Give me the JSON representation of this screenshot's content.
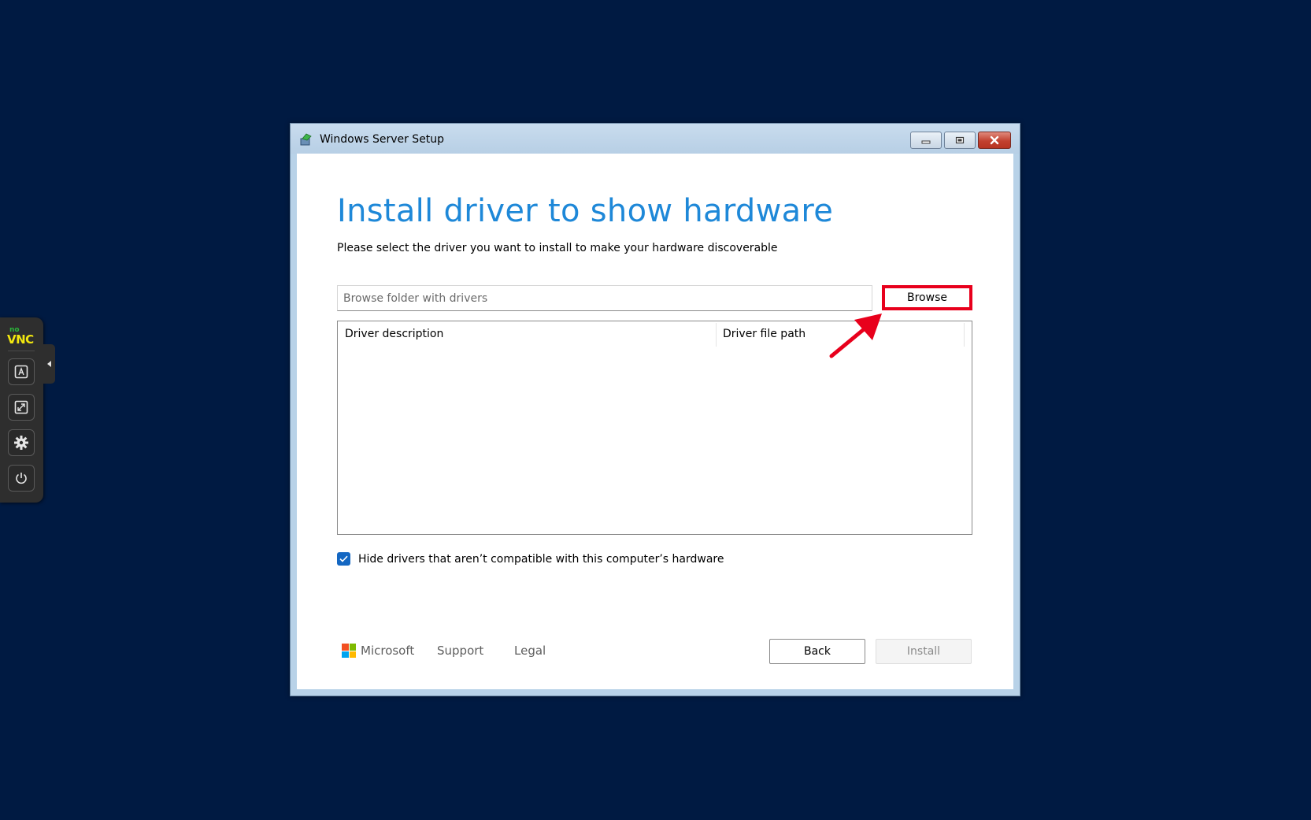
{
  "window": {
    "title": "Windows Server Setup"
  },
  "page": {
    "heading": "Install driver to show hardware",
    "subtitle": "Please select the driver you want to install to make your hardware discoverable"
  },
  "folder": {
    "placeholder": "Browse folder with drivers",
    "value": "",
    "browse_label": "Browse"
  },
  "table": {
    "columns": [
      "Driver description",
      "Driver file path"
    ],
    "rows": []
  },
  "options": {
    "hide_incompatible_label": "Hide drivers that aren’t compatible with this computer’s hardware",
    "hide_incompatible_checked": true
  },
  "footer": {
    "brand": "Microsoft",
    "support": "Support",
    "legal": "Legal",
    "back": "Back",
    "install": "Install",
    "install_enabled": false
  },
  "vnc": {
    "logo_top": "no",
    "logo_bottom": "VNC",
    "buttons": [
      "keyboard-icon",
      "fullscreen-icon",
      "settings-icon",
      "power-icon"
    ]
  },
  "colors": {
    "desktop": "#001a42",
    "heading": "#1e88d8",
    "highlight": "#e8001c",
    "checkbox": "#1467c2"
  }
}
